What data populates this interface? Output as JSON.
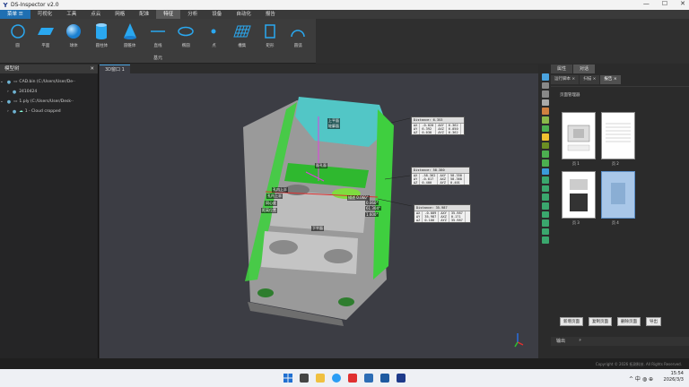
{
  "app": {
    "title": "DS-Inspector v2.0",
    "logo": "Y"
  },
  "window_controls": {
    "minimize": "—",
    "maximize": "☐",
    "close": "✕"
  },
  "menu": [
    "菜单 ☰",
    "可视化",
    "工具",
    "点云",
    "网格",
    "配准",
    "特征",
    "分析",
    "设备",
    "自动化",
    "报告"
  ],
  "menu_active_index": 6,
  "ribbon": {
    "tools": [
      "圆",
      "平面",
      "球体",
      "圆柱体",
      "圆锥体",
      "直线",
      "椭圆",
      "点",
      "槽集",
      "矩形",
      "圆弧"
    ],
    "group_label": "基元"
  },
  "model_tree": {
    "title": "模型树",
    "close": "✕",
    "items": [
      {
        "label": "CAD.bin (C:/Users/User/De··",
        "level": 0
      },
      {
        "label": "2410424",
        "level": 1
      },
      {
        "label": "1.ply (C:/Users/User/Desk··",
        "level": 0
      },
      {
        "label": "1 - Cloud cropped",
        "level": 1
      }
    ]
  },
  "doc_tab": "3D窗口 1",
  "viewport": {
    "labels": [
      "上平面",
      "轮廓面",
      "面孔面",
      "孔内上半",
      "孔内上半",
      "同心度",
      "距离位置",
      "下平面",
      "描述 0.060°",
      "0.060°",
      "61.304°",
      "1.600°"
    ],
    "boxes": [
      {
        "title": "Distance: 6.353",
        "rows": [
          [
            "ΔX",
            "-0.020",
            "ΔXY",
            "6.362"
          ],
          [
            "ΔY",
            "6.392",
            "ΔXZ",
            "6.050"
          ],
          [
            "ΔZ",
            "0.038",
            "ΔYZ",
            "6.362"
          ]
        ]
      },
      {
        "title": "Distance: 58.380",
        "rows": [
          [
            "ΔX",
            "-58.362",
            "ΔXY",
            "58.358"
          ],
          [
            "ΔY",
            "-0.017",
            "ΔXZ",
            "58.368"
          ],
          [
            "ΔZ",
            "0.400",
            "ΔYZ",
            "0.401"
          ]
        ]
      },
      {
        "title": "Distance: 35.987",
        "rows": [
          [
            "ΔX",
            "-0.009",
            "ΔXY",
            "35.987"
          ],
          [
            "ΔY",
            "35.987",
            "ΔXZ",
            "0.171"
          ],
          [
            "ΔZ",
            "0.166",
            "ΔYZ",
            "35.987"
          ]
        ]
      }
    ]
  },
  "right_panel": {
    "tabs": [
      "属性",
      "对话"
    ],
    "subtabs": [
      "运行脚本 ×",
      "扫描 ×",
      "报告 ×"
    ],
    "page_manager_label": "页面管理器",
    "thumb_labels": [
      "页 1",
      "页 2",
      "页 3",
      "页 4"
    ],
    "buttons": [
      "新增页面",
      "复制页面",
      "删除页面",
      "导出"
    ],
    "output_label": "输出",
    "output_pin": "ᵖ"
  },
  "status": {
    "copyright": "Copyright © 2026 拓测科技. All Rights Reserved."
  },
  "taskbar": {
    "time": "15:54",
    "date": "2026/3/3",
    "tray_text": "^  中  ◍  ⊕"
  },
  "colors": {
    "accent": "#1f6fb2",
    "cyan_surface": "#52c6c6",
    "green_surface": "#3fcf3f",
    "ribbon_icon": "#2aa8f0"
  }
}
